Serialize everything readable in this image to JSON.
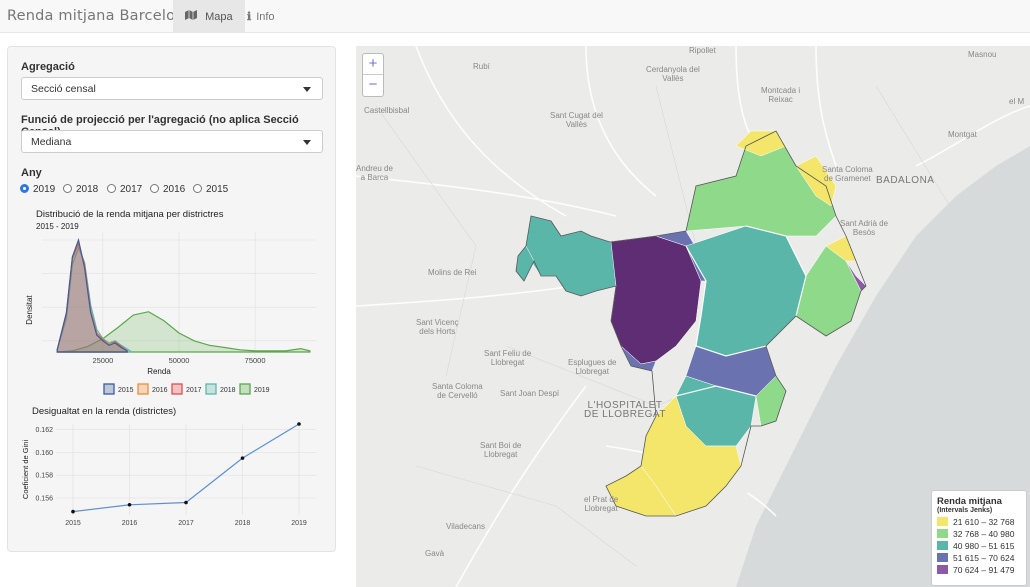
{
  "navbar": {
    "brand": "Renda mitjana Barcelona",
    "tabs": [
      {
        "label": "Mapa",
        "icon": "map-icon",
        "active": true
      },
      {
        "label": "Info",
        "icon": "info-icon",
        "active": false
      }
    ]
  },
  "sidebar": {
    "agregacio": {
      "label": "Agregació",
      "value": "Secció censal"
    },
    "funcio": {
      "label": "Funció de projecció per l'agregació (no aplica Secció Censal)",
      "value": "Mediana"
    },
    "any": {
      "label": "Any",
      "options": [
        "2019",
        "2018",
        "2017",
        "2016",
        "2015"
      ],
      "selected": "2019"
    }
  },
  "chart_data": [
    {
      "type": "area",
      "title": "Distribució de la renda mitjana per districtres",
      "subtitle": "2015 - 2019",
      "xlabel": "Renda",
      "ylabel": "Densitat",
      "xlim": [
        5000,
        95000
      ],
      "xticks": [
        "25000",
        "50000",
        "75000"
      ],
      "grid": true,
      "legend_position": "bottom",
      "series": [
        {
          "name": "2015",
          "color": "#3d5c9a",
          "x": [
            10000,
            13000,
            15000,
            17000,
            19000,
            21000,
            23000,
            25000,
            27000,
            29000,
            31000,
            33000
          ],
          "y": [
            0.02,
            0.35,
            0.85,
            1.0,
            0.75,
            0.35,
            0.15,
            0.1,
            0.06,
            0.08,
            0.04,
            0.01
          ]
        },
        {
          "name": "2016",
          "color": "#f08c3a",
          "x": [
            10000,
            13000,
            15000,
            17000,
            19000,
            21000,
            23000,
            25000,
            27000,
            29000,
            31000,
            33000
          ],
          "y": [
            0.02,
            0.35,
            0.84,
            0.99,
            0.76,
            0.36,
            0.16,
            0.1,
            0.07,
            0.08,
            0.04,
            0.01
          ]
        },
        {
          "name": "2017",
          "color": "#e05050",
          "x": [
            10000,
            13000,
            15000,
            17000,
            19000,
            21000,
            23000,
            25000,
            27000,
            29000,
            31000,
            33000
          ],
          "y": [
            0.02,
            0.34,
            0.83,
            0.97,
            0.78,
            0.37,
            0.17,
            0.11,
            0.07,
            0.09,
            0.05,
            0.01
          ]
        },
        {
          "name": "2018",
          "color": "#5bb8b0",
          "x": [
            10000,
            13000,
            15000,
            17000,
            19000,
            21000,
            23000,
            25000,
            27000,
            29000,
            31000,
            34000
          ],
          "y": [
            0.02,
            0.3,
            0.78,
            0.93,
            0.8,
            0.42,
            0.2,
            0.12,
            0.08,
            0.1,
            0.06,
            0.01
          ]
        },
        {
          "name": "2019",
          "color": "#5aa84a",
          "x": [
            10000,
            15000,
            20000,
            25000,
            30000,
            35000,
            40000,
            45000,
            50000,
            55000,
            60000,
            65000,
            70000,
            75000,
            80000,
            85000,
            90000,
            93000
          ],
          "y": [
            0.0,
            0.01,
            0.05,
            0.12,
            0.22,
            0.33,
            0.36,
            0.28,
            0.17,
            0.1,
            0.06,
            0.04,
            0.02,
            0.01,
            0.01,
            0.01,
            0.03,
            0.01
          ]
        }
      ]
    },
    {
      "type": "line",
      "title": "Desigualtat en la renda (districtes)",
      "xlabel": "",
      "ylabel": "Coeficient de Gini",
      "ylim": [
        0.1545,
        0.1625
      ],
      "yticks": [
        "0.162",
        "0.160",
        "0.158",
        "0.156"
      ],
      "grid": true,
      "categories": [
        "2015",
        "2016",
        "2017",
        "2018",
        "2019"
      ],
      "values": [
        0.1548,
        0.1554,
        0.1556,
        0.1595,
        0.1625
      ],
      "line_color": "#5b8fd8"
    }
  ],
  "map": {
    "zoom_in": "+",
    "zoom_out": "−",
    "places": [
      {
        "name": "Ripollet",
        "big": false
      },
      {
        "name": "Rubí",
        "big": false
      },
      {
        "name": "Cerdanyola del\nVallès",
        "big": false
      },
      {
        "name": "Montcada i\nReixac",
        "big": false
      },
      {
        "name": "Castellbisbal",
        "big": false
      },
      {
        "name": "Sant Cugat del\nVallès",
        "big": false
      },
      {
        "name": "Montgat",
        "big": false
      },
      {
        "name": "Andreu de\na Barca",
        "big": false
      },
      {
        "name": "Santa Coloma\nde Gramenet",
        "big": false
      },
      {
        "name": "BADALONA",
        "big": true
      },
      {
        "name": "Sant Adrià de\nBesòs",
        "big": false
      },
      {
        "name": "Molins de Rei",
        "big": false
      },
      {
        "name": "Sant Vicenç\ndels Horts",
        "big": false
      },
      {
        "name": "Sant Feliu de\nLlobregat",
        "big": false
      },
      {
        "name": "Esplugues de\nLlobregat",
        "big": false
      },
      {
        "name": "Santa Coloma\nde Cervelló",
        "big": false
      },
      {
        "name": "Sant Joan Despí",
        "big": false
      },
      {
        "name": "L'HOSPITALET\nDE LLOBREGAT",
        "big": true
      },
      {
        "name": "Sant Boi de\nLlobregat",
        "big": false
      },
      {
        "name": "el Prat de\nLlobregat",
        "big": false
      },
      {
        "name": "Viladecans",
        "big": false
      },
      {
        "name": "Gavà",
        "big": false
      },
      {
        "name": "Masnou",
        "big": false
      },
      {
        "name": "el M",
        "big": false
      }
    ],
    "legend": {
      "title": "Renda mitjana",
      "subtitle": "(Intervals Jenks)",
      "items": [
        {
          "label": "21 610 – 32 768",
          "color": "#f3e66a"
        },
        {
          "label": "32 768 – 40 980",
          "color": "#8fd98a"
        },
        {
          "label": "40 980 – 51 615",
          "color": "#59b6a8"
        },
        {
          "label": "51 615 – 70 624",
          "color": "#6a72b0"
        },
        {
          "label": "70 624 – 91 479",
          "color": "#8e5aa6"
        }
      ]
    }
  }
}
